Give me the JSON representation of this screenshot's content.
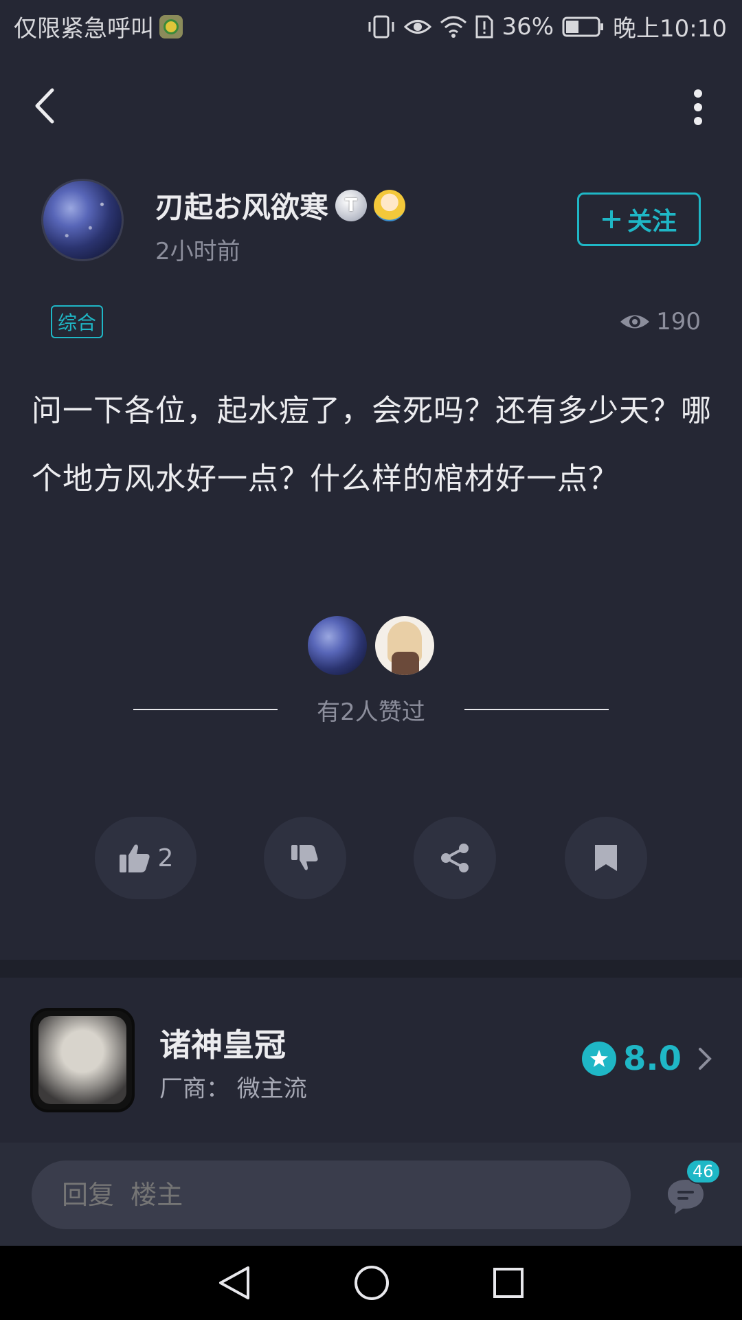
{
  "status_bar": {
    "carrier_text": "仅限紧急呼叫",
    "battery_percent": "36%",
    "time": "晚上10:10"
  },
  "author": {
    "name": "刃起お风欲寒",
    "badge_letter": "T",
    "time_ago": "2小时前",
    "follow_label": "关注"
  },
  "post": {
    "tag": "综合",
    "views": "190",
    "content": "问一下各位，起水痘了，会死吗？还有多少天？哪个地方风水好一点？什么样的棺材好一点？"
  },
  "likes": {
    "summary": "有2人赞过",
    "like_count": "2"
  },
  "game": {
    "title": "诸神皇冠",
    "vendor": "厂商： 微主流",
    "rating": "8.0"
  },
  "reply": {
    "placeholder": "回复  楼主",
    "comment_count": "46"
  },
  "colors": {
    "background": "#252734",
    "accent": "#1fb7c6"
  }
}
